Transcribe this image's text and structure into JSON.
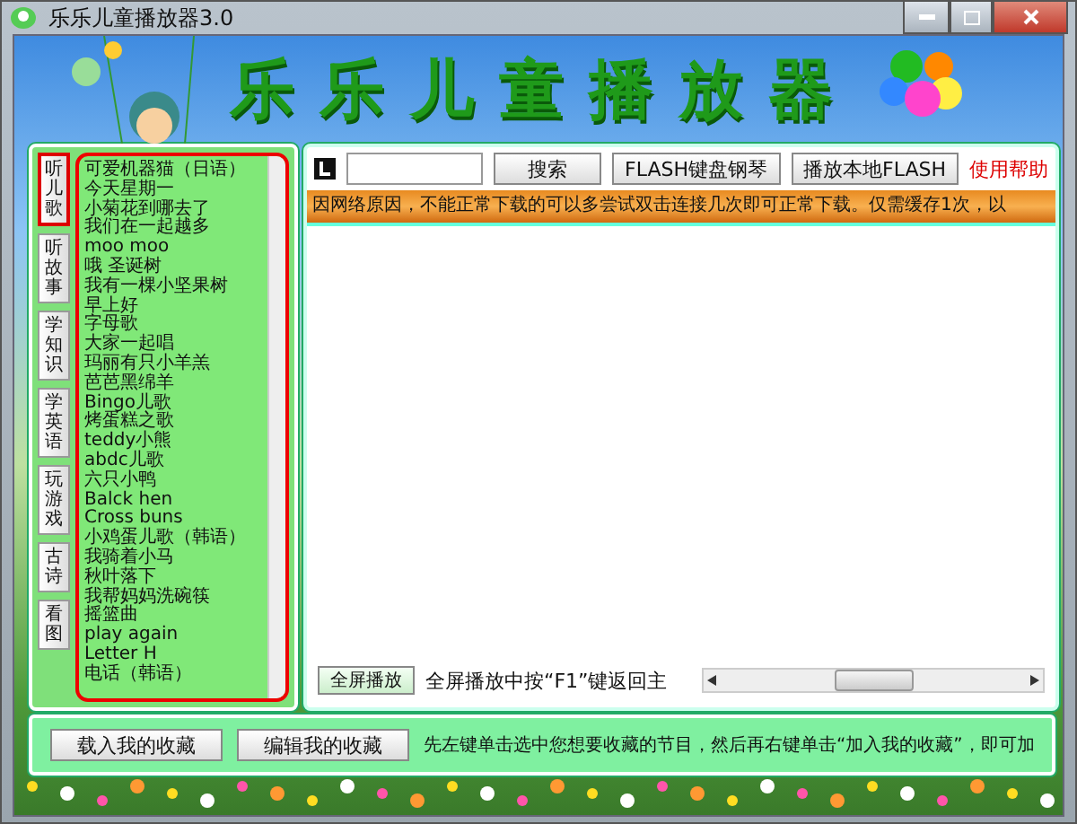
{
  "window": {
    "title": "乐乐儿童播放器3.0"
  },
  "banner": {
    "title": "乐乐儿童播放器"
  },
  "tabs": [
    {
      "label": "听儿歌",
      "selected": true
    },
    {
      "label": "听故事",
      "selected": false
    },
    {
      "label": "学知识",
      "selected": false
    },
    {
      "label": "学英语",
      "selected": false
    },
    {
      "label": "玩游戏",
      "selected": false
    },
    {
      "label": "古诗",
      "selected": false
    },
    {
      "label": "看图",
      "selected": false
    }
  ],
  "songs": [
    "可爱机器猫（日语）",
    "今天星期一",
    "小菊花到哪去了",
    "我们在一起越多",
    "moo moo",
    "哦 圣诞树",
    "我有一棵小坚果树",
    "早上好",
    "字母歌",
    "大家一起唱",
    "玛丽有只小羊羔",
    "芭芭黑绵羊",
    "Bingo儿歌",
    "烤蛋糕之歌",
    "teddy小熊",
    "abdc儿歌",
    "六只小鸭",
    "Balck hen",
    "Cross buns",
    "小鸡蛋儿歌（韩语）",
    "我骑着小马",
    "秋叶落下",
    "我帮妈妈洗碗筷",
    "摇篮曲",
    "play  again",
    "Letter H",
    "电话（韩语）"
  ],
  "toolbar": {
    "search_button": "搜索",
    "piano_button": "FLASH键盘钢琴",
    "local_button": "播放本地FLASH",
    "help_link": "使用帮助"
  },
  "notice": "因网络原因，不能正常下载的可以多尝试双击连接几次即可正常下载。仅需缓存1次，以",
  "player": {
    "fullscreen_button": "全屏播放",
    "hint": "全屏播放中按“F1”键返回主"
  },
  "favorites": {
    "buttons": [
      "载入我的收藏",
      "编辑我的收藏"
    ],
    "hint": "先左键单击选中您想要收藏的节目，然后再右键单击“加入我的收藏”，即可加"
  }
}
